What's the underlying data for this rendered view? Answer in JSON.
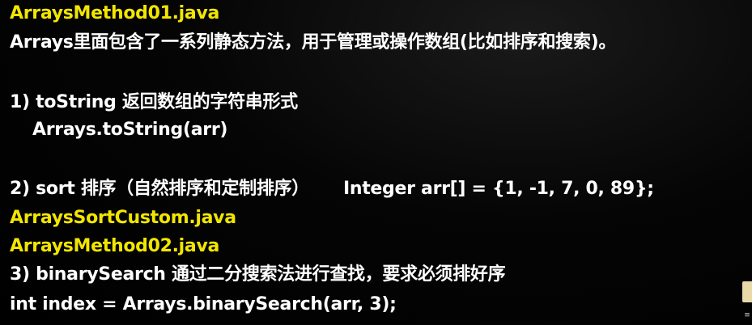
{
  "lines": {
    "file1": "ArraysMethod01.java",
    "intro": "Arrays里面包含了一系列静态方法，用于管理或操作数组(比如排序和搜索)。",
    "item1_title": "1) toString 返回数组的字符串形式",
    "item1_code": "Arrays.toString(arr)",
    "item2_title": "2) sort 排序（自然排序和定制排序）",
    "item2_code": "Integer arr[] = {1, -1, 7, 0, 89};",
    "file2": "ArraysSortCustom.java",
    "file3": "ArraysMethod02.java",
    "item3_title": "3) binarySearch 通过二分搜索法进行查找，要求必须排好序",
    "item3_code": "int index = Arrays.binarySearch(arr, 3);"
  },
  "colors": {
    "background": "#000000",
    "text": "#ffffff",
    "highlight": "#f2e600"
  }
}
